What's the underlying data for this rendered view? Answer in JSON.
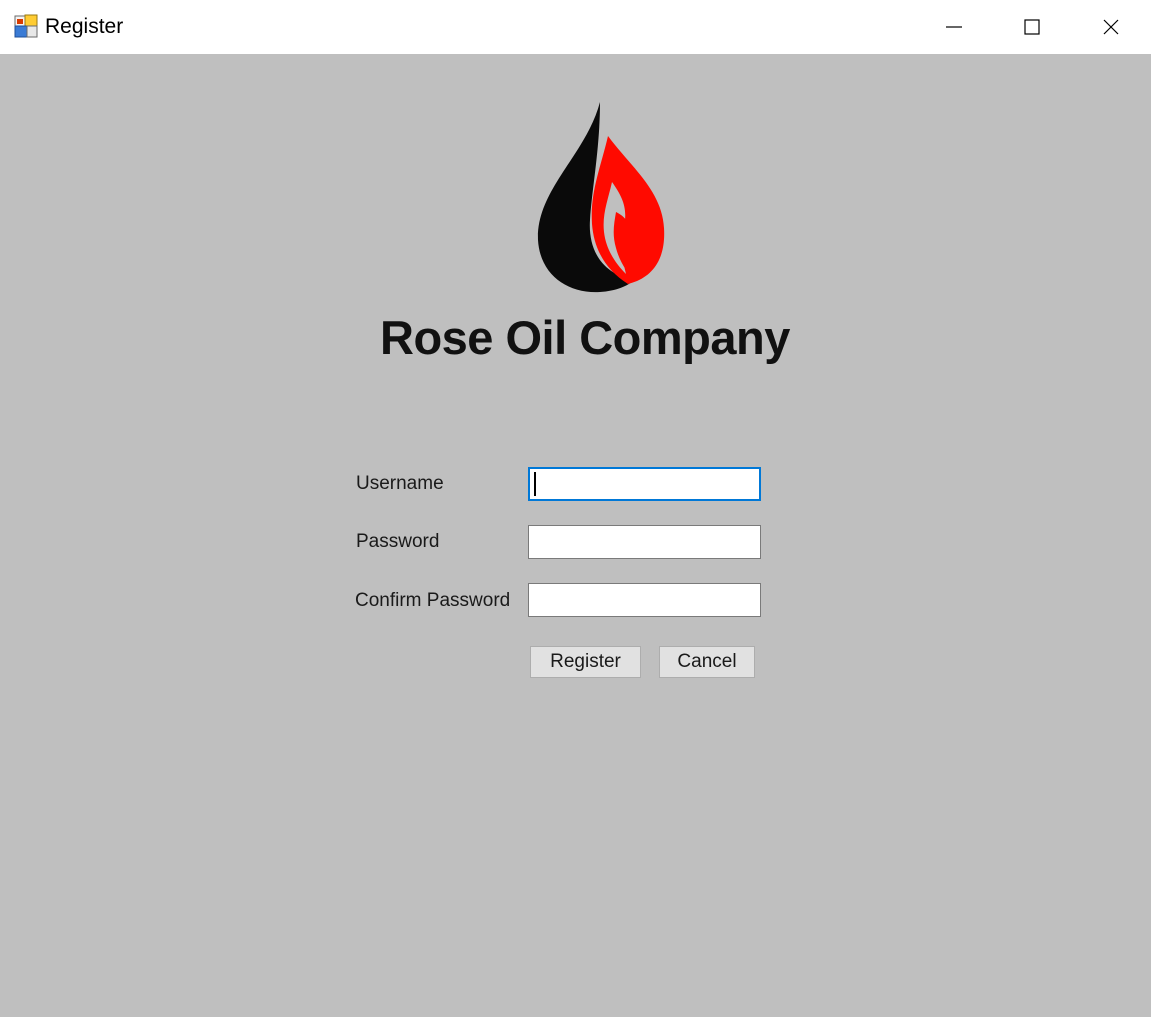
{
  "window": {
    "title": "Register",
    "icon": "winforms-app-icon",
    "controls": {
      "minimize": "minimize-icon",
      "maximize": "maximize-icon",
      "close": "close-icon"
    }
  },
  "logo": {
    "company_name": "Rose Oil Company",
    "colors": {
      "black_flame": "#0a0a0a",
      "red_flame": "#ff0a00",
      "gap": "#bfbfbf"
    }
  },
  "form": {
    "username_label": "Username",
    "username_value": "",
    "password_label": "Password",
    "password_value": "",
    "confirm_label": "Confirm Password",
    "confirm_value": ""
  },
  "buttons": {
    "register_label": "Register",
    "cancel_label": "Cancel"
  },
  "colors": {
    "client_background": "#bfbfbf",
    "focus_border": "#0078d7"
  }
}
